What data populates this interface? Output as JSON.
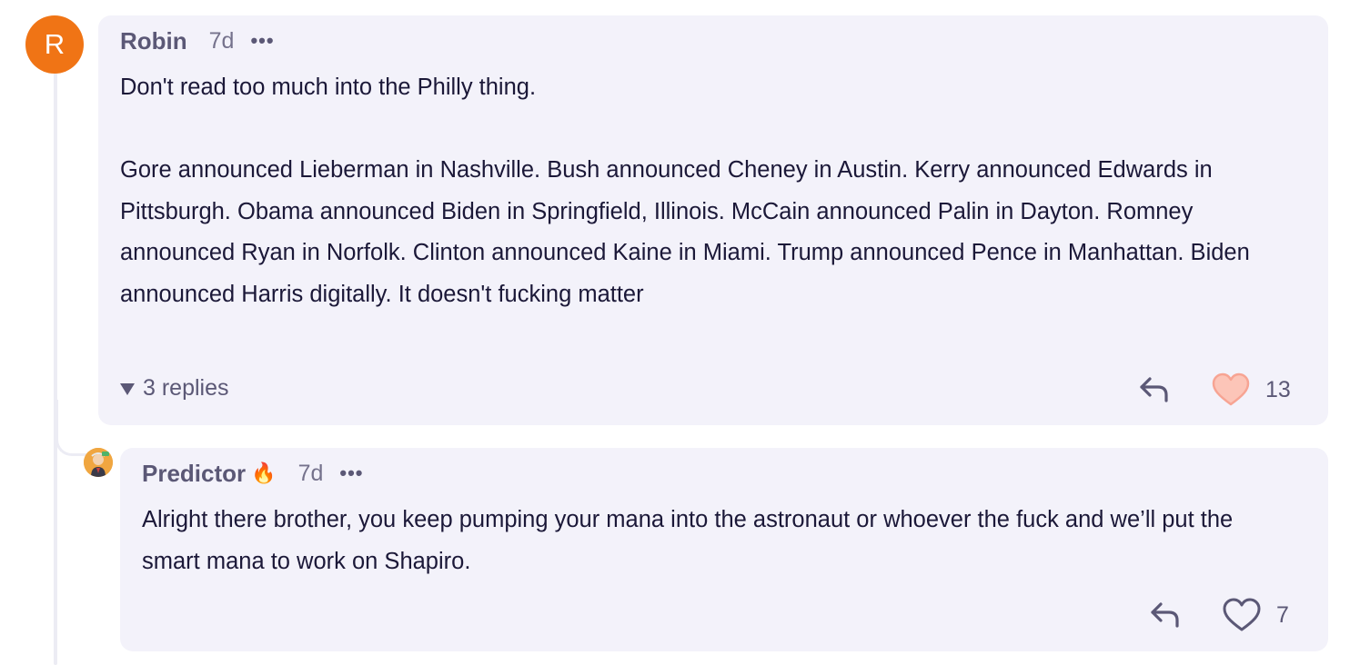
{
  "comments": [
    {
      "avatar_letter": "R",
      "avatar_color": "#f07415",
      "author": "Robin",
      "time": "7d",
      "more": "•••",
      "paragraphs": [
        "Don't read too much into the Philly thing.",
        "Gore announced Lieberman in Nashville. Bush announced Cheney in Austin. Kerry announced Edwards in Pittsburgh. Obama announced Biden in Springfield, Illinois. McCain announced Palin in Dayton. Romney announced Ryan in Norfolk. Clinton announced Kaine in Miami. Trump announced Pence in Manhattan. Biden announced Harris digitally. It doesn't fucking matter"
      ],
      "replies_label": "3 replies",
      "like_count": "13",
      "liked": true,
      "reply_icon": "reply-arrow-icon",
      "like_icon": "heart-icon"
    },
    {
      "author": "Predictor",
      "author_badge": "🔥",
      "time": "7d",
      "more": "•••",
      "paragraphs": [
        "Alright there brother, you keep pumping your mana into the astronaut or whoever the fuck and we’ll put the smart mana to work on Shapiro."
      ],
      "like_count": "7",
      "liked": false,
      "reply_icon": "reply-arrow-icon",
      "like_icon": "heart-icon"
    }
  ],
  "colors": {
    "card_bg": "#f3f2fa",
    "heart_liked": "#fcc5b8",
    "text_muted": "#5b5876"
  }
}
